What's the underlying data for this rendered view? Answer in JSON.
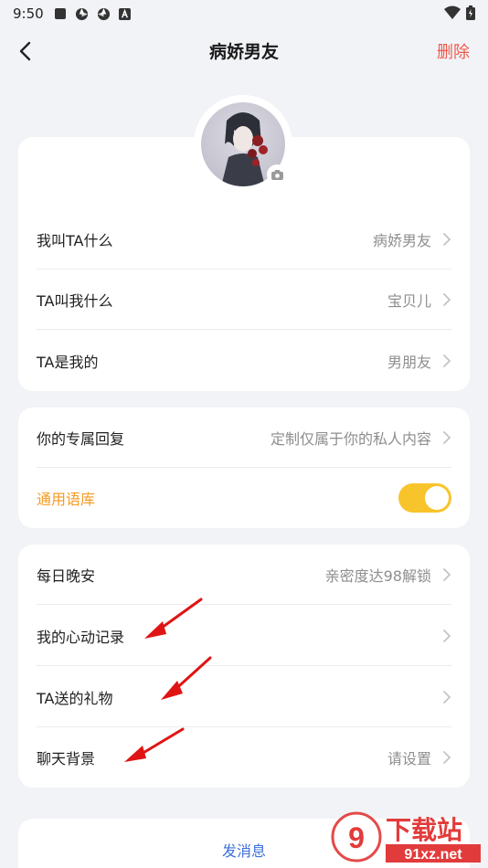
{
  "status_bar": {
    "time": "9:50"
  },
  "header": {
    "title": "病娇男友",
    "delete_label": "删除"
  },
  "profile_card": {
    "rows": [
      {
        "label": "我叫TA什么",
        "value": "病娇男友"
      },
      {
        "label": "TA叫我什么",
        "value": "宝贝儿"
      },
      {
        "label": "TA是我的",
        "value": "男朋友"
      }
    ]
  },
  "reply_card": {
    "exclusive_label": "你的专属回复",
    "exclusive_value": "定制仅属于你的私人内容",
    "library_label": "通用语库",
    "library_enabled": true
  },
  "feature_card": {
    "rows": [
      {
        "label": "每日晚安",
        "value": "亲密度达98解锁"
      },
      {
        "label": "我的心动记录",
        "value": ""
      },
      {
        "label": "TA送的礼物",
        "value": ""
      },
      {
        "label": "聊天背景",
        "value": "请设置"
      }
    ]
  },
  "bottom": {
    "send_label": "发消息"
  },
  "watermark": {
    "text_big": "下载站",
    "text_small": "91xz.net"
  },
  "colors": {
    "accent_red": "#f0594a",
    "accent_orange": "#f59a23",
    "toggle_on": "#f8c42b",
    "send_blue": "#3b6fd9"
  }
}
